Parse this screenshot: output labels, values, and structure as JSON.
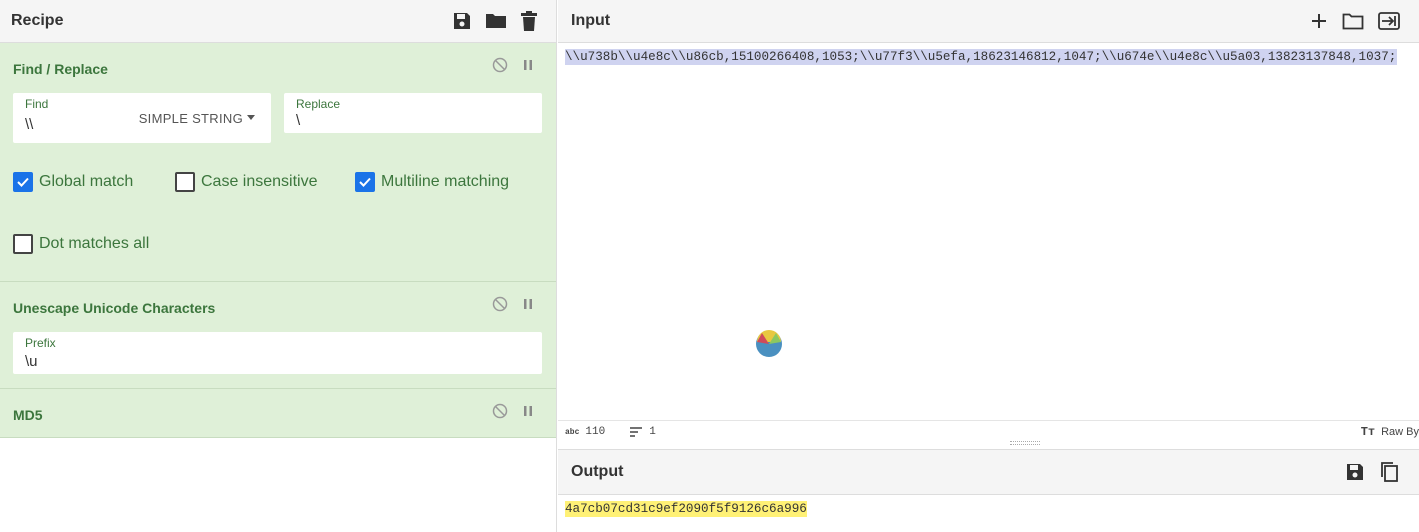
{
  "recipe": {
    "title": "Recipe",
    "operations": [
      {
        "name": "Find / Replace",
        "find_label": "Find",
        "find_value": "\\\\",
        "find_mode": "SIMPLE STRING",
        "replace_label": "Replace",
        "replace_value": "\\",
        "options": [
          {
            "label": "Global match",
            "checked": true
          },
          {
            "label": "Case insensitive",
            "checked": false
          },
          {
            "label": "Multiline matching",
            "checked": true
          },
          {
            "label": "Dot matches all",
            "checked": false
          }
        ]
      },
      {
        "name": "Unescape Unicode Characters",
        "prefix_label": "Prefix",
        "prefix_value": "\\u"
      },
      {
        "name": "MD5"
      }
    ]
  },
  "input": {
    "title": "Input",
    "text": "\\\\u738b\\\\u4e8c\\\\u86cb,15100266408,1053;\\\\u77f3\\\\u5efa,18623146812,1047;\\\\u674e\\\\u4e8c\\\\u5a03,13823137848,1037;",
    "status": {
      "length_label": "abc",
      "length": "110",
      "lines": "1",
      "mode": "Raw By"
    }
  },
  "output": {
    "title": "Output",
    "text": "4a7cb07cd31c9ef2090f5f9126c6a996"
  },
  "colors": {
    "op_bg": "#dff0d8",
    "op_text": "#3c763d",
    "checkbox_on": "#1a73e8",
    "input_highlight": "#cfd3f0",
    "output_highlight": "#fff176"
  }
}
